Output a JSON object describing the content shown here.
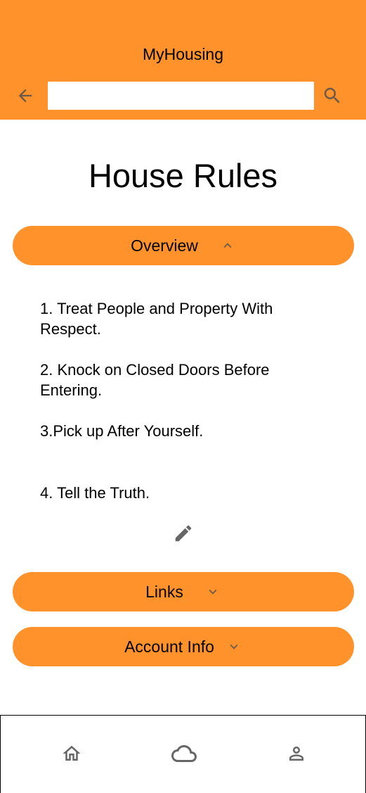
{
  "app": {
    "title": "MyHousing"
  },
  "header": {
    "back_icon": "arrow-back-icon",
    "search": {
      "value": "",
      "placeholder": ""
    },
    "search_icon": "search-icon"
  },
  "page": {
    "title": "House Rules"
  },
  "sections": {
    "overview": {
      "label": "Overview",
      "state": "expanded",
      "icon": "chevron-up-icon"
    },
    "links": {
      "label": "Links",
      "state": "collapsed",
      "icon": "chevron-down-icon"
    },
    "account_info": {
      "label": "Account Info",
      "state": "collapsed",
      "icon": "chevron-down-icon"
    }
  },
  "rules": [
    "1. Treat People and Property With Respect.",
    "2. Knock on Closed Doors Before Entering.",
    "3.Pick up After Yourself.",
    "4. Tell the Truth."
  ],
  "edit_icon": "pencil-icon",
  "bottom_nav": {
    "items": [
      {
        "name": "home",
        "icon": "home-icon"
      },
      {
        "name": "cloud",
        "icon": "cloud-icon"
      },
      {
        "name": "profile",
        "icon": "person-icon"
      }
    ]
  },
  "colors": {
    "accent": "#ff922b",
    "icon_gray": "#666666",
    "background": "#ffffff"
  }
}
